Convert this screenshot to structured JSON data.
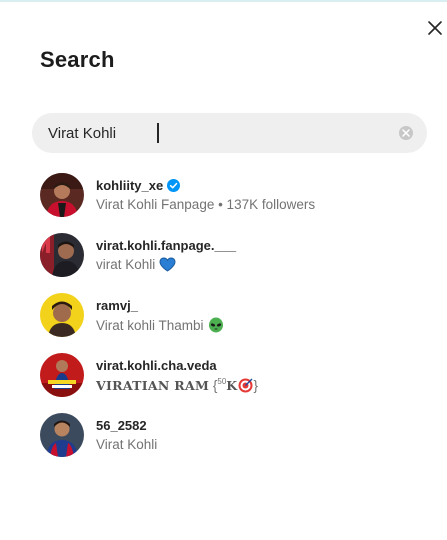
{
  "panel": {
    "title": "Search",
    "close_icon": "close-icon"
  },
  "search": {
    "value": "Virat Kohli",
    "clear_icon": "clear-circle-icon"
  },
  "results": [
    {
      "username": "kohliity_xe",
      "verified": true,
      "subtitle": "Virat Kohli Fanpage • 137K followers"
    },
    {
      "username": "virat.kohli.fanpage.___",
      "subtitle": "virat Kohli",
      "emoji": "blue-heart-icon"
    },
    {
      "username": "ramvj_",
      "subtitle": "Virat kohli Thambi",
      "emoji": "alien-icon"
    },
    {
      "username": "virat.kohli.cha.veda",
      "subtitle_prefix": "VIRATIAN RAM",
      "subtitle_brace_open": "{",
      "subtitle_sup": "50",
      "subtitle_k": "K",
      "subtitle_brace_close": "}",
      "emoji": "target-icon"
    },
    {
      "username": "56_2582",
      "subtitle": "Virat Kohli"
    }
  ],
  "colors": {
    "verified": "#0095f6",
    "search_bg": "#efefef",
    "muted_text": "#737373"
  }
}
